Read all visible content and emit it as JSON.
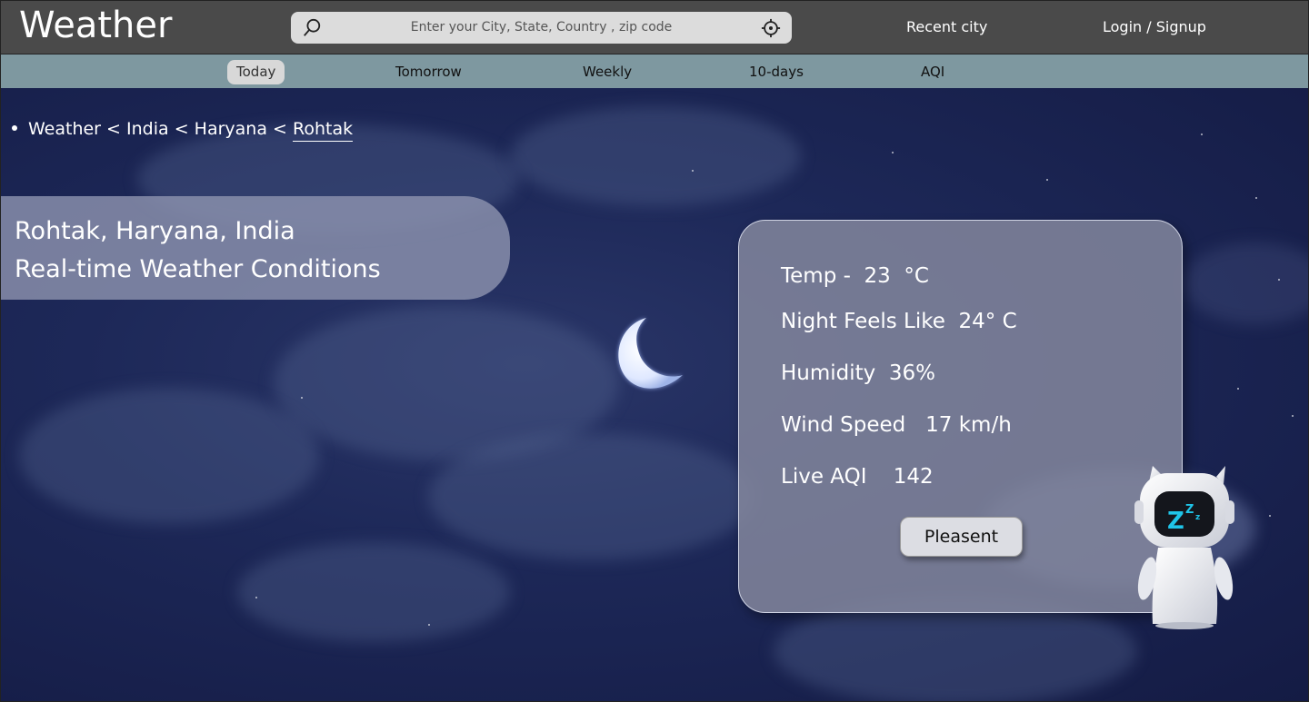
{
  "header": {
    "logo": "Weather",
    "search": {
      "placeholder": "Enter your City, State, Country , zip code"
    },
    "recent_city": "Recent city",
    "login": "Login / Signup"
  },
  "nav": {
    "tabs": [
      {
        "label": "Today",
        "active": true
      },
      {
        "label": "Tomorrow"
      },
      {
        "label": "Weekly"
      },
      {
        "label": "10-days"
      },
      {
        "label": "AQI"
      }
    ]
  },
  "breadcrumb": {
    "items": [
      "Weather",
      "India",
      "Haryana",
      "Rohtak"
    ],
    "separator": "<"
  },
  "location_title": {
    "line1": "Rohtak, Haryana, India",
    "line2": "Real-time Weather Conditions"
  },
  "weather_card": {
    "temp": "Temp -  23  °C",
    "feels_like": "Night Feels Like  24° C",
    "humidity": "Humidity  36%",
    "wind": "Wind Speed   17 km/h",
    "aqi": "Live AQI    142",
    "status_button": "Pleasent"
  },
  "colors": {
    "header_bg": "#4a4a4a",
    "nav_bg": "#7e98a0",
    "sky_bg": "#1d2858",
    "robot_eye": "#1fc4e8"
  }
}
